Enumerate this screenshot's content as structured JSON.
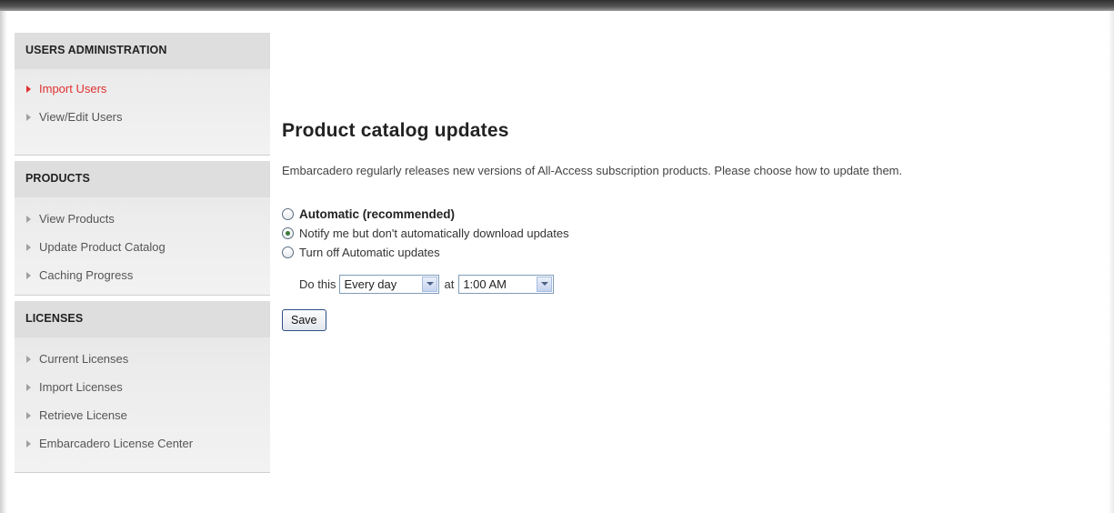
{
  "sidebar": {
    "users": {
      "title": "USERS ADMINISTRATION",
      "items": [
        {
          "label": "Import Users",
          "active": true
        },
        {
          "label": "View/Edit Users",
          "active": false
        }
      ]
    },
    "products": {
      "title": "PRODUCTS",
      "items": [
        {
          "label": "View Products"
        },
        {
          "label": "Update Product Catalog"
        },
        {
          "label": "Caching Progress"
        }
      ]
    },
    "licenses": {
      "title": "LICENSES",
      "items": [
        {
          "label": "Current Licenses"
        },
        {
          "label": "Import Licenses"
        },
        {
          "label": "Retrieve License"
        },
        {
          "label": "Embarcadero License Center"
        }
      ]
    }
  },
  "main": {
    "title": "Product catalog updates",
    "intro": "Embarcadero regularly releases new versions of All-Access subscription products. Please choose how to update them.",
    "options": [
      {
        "label": "Automatic (recommended)",
        "checked": false
      },
      {
        "label": "Notify me but don't automatically download updates",
        "checked": true
      },
      {
        "label": "Turn off Automatic updates",
        "checked": false
      }
    ],
    "schedule": {
      "prefix": "Do this",
      "frequency": "Every day",
      "at": "at",
      "time": "1:00 AM"
    },
    "save_label": "Save"
  },
  "colors": {
    "active_link": "#e03030",
    "sidebar_bg": "#ececec",
    "text": "#333333"
  }
}
